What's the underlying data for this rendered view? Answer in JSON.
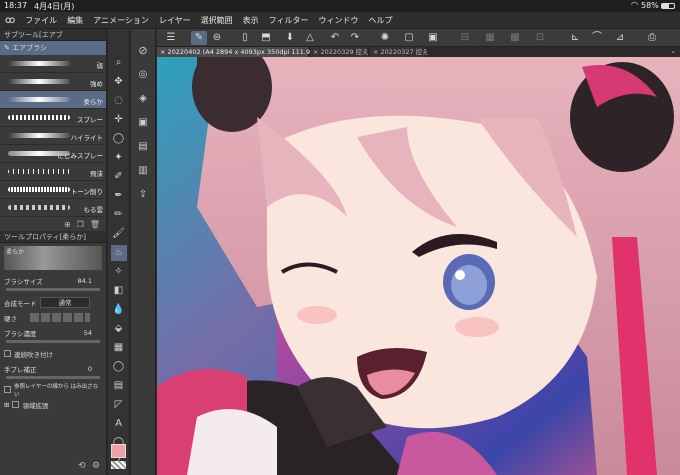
{
  "status": {
    "time": "18:37",
    "date": "4月4日(月)",
    "battery": "58%"
  },
  "menu": [
    "ファイル",
    "編集",
    "アニメーション",
    "レイヤー",
    "選択範囲",
    "表示",
    "フィルター",
    "ウィンドウ",
    "ヘルプ"
  ],
  "subtool": {
    "header": "サブツール[エアブ",
    "category": "エアブラシ",
    "brushes": [
      {
        "label": "弱"
      },
      {
        "label": "強め"
      },
      {
        "label": "柔らか"
      },
      {
        "label": "スプレー"
      },
      {
        "label": "ハイライト"
      },
      {
        "label": "にじみスプレー"
      },
      {
        "label": "飛沫"
      },
      {
        "label": "トーン削り"
      },
      {
        "label": "もる雲"
      }
    ]
  },
  "toolprop": {
    "header": "ツールプロパティ[柔らか]",
    "preview_label": "柔らか",
    "brush_size_label": "ブラシサイズ",
    "brush_size": "84.1",
    "blend_label": "合成モード",
    "blend_value": "通常",
    "hardness_label": "硬さ",
    "density_label": "ブラシ濃度",
    "density": "54",
    "continuous_label": "連続吹き付け",
    "stabilization_label": "手ブレ補正",
    "stabilization": "0",
    "ref_layer_label": "参照レイヤーの線から はみ出さない",
    "expand_label": "領域拡張"
  },
  "tabs": [
    {
      "label": "20220402 (A4 2894 x 4093px 350dpi 111.9%)"
    },
    {
      "label": "20220329 控え"
    },
    {
      "label": "20220327 控え"
    }
  ],
  "colors": {
    "accent": "#5b6b86",
    "main_color": "#f3a0a8"
  }
}
